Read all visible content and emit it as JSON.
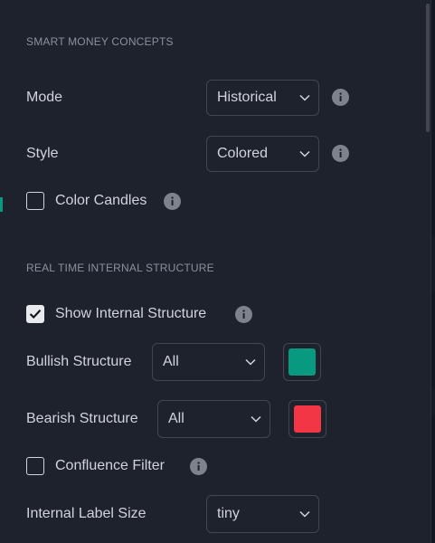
{
  "colors": {
    "panel_bg": "#1e222d",
    "text": "#d1d4dc",
    "muted": "#8c909c",
    "border": "#434651",
    "bullish": "#089981",
    "bearish": "#f23645"
  },
  "sections": {
    "smc_title": "SMART MONEY CONCEPTS",
    "internal_title": "REAL TIME INTERNAL STRUCTURE"
  },
  "mode": {
    "label": "Mode",
    "value": "Historical",
    "icon": "info-icon"
  },
  "style": {
    "label": "Style",
    "value": "Colored",
    "icon": "info-icon"
  },
  "color_candles": {
    "label": "Color Candles",
    "checked": false
  },
  "show_internal": {
    "label": "Show Internal Structure",
    "checked": true
  },
  "bullish_structure": {
    "label": "Bullish Structure",
    "value": "All",
    "color": "#089981"
  },
  "bearish_structure": {
    "label": "Bearish Structure",
    "value": "All",
    "color": "#f23645"
  },
  "confluence_filter": {
    "label": "Confluence Filter",
    "checked": false
  },
  "internal_label_size": {
    "label": "Internal Label Size",
    "value": "tiny"
  }
}
